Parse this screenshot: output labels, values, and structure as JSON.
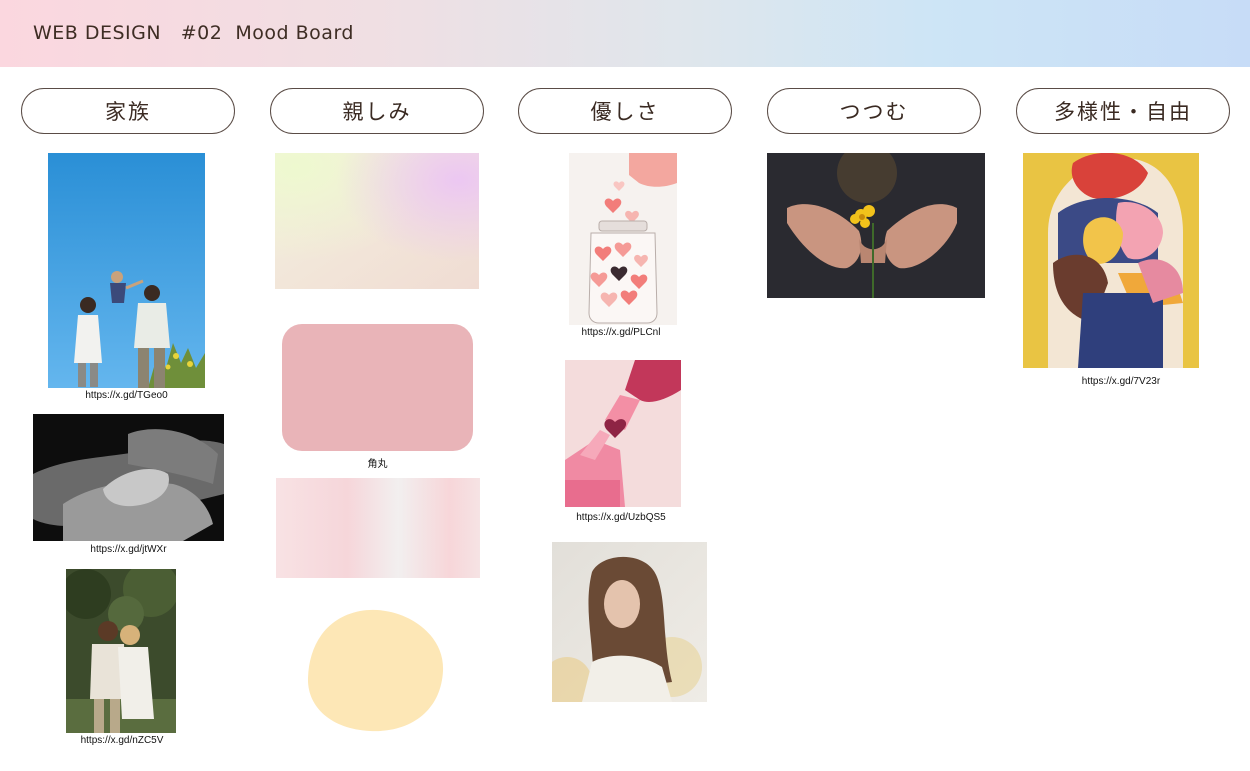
{
  "header": {
    "title": "WEB DESIGN   #02  Mood Board"
  },
  "columns": [
    {
      "label": "家族"
    },
    {
      "label": "親しみ"
    },
    {
      "label": "優しさ"
    },
    {
      "label": "つつむ"
    },
    {
      "label": "多様性・自由"
    }
  ],
  "captions": {
    "family_1": "https://x.gd/TGeo0",
    "family_2": "https://x.gd/jtWXr",
    "family_3": "https://x.gd/nZC5V",
    "familiar_card": "角丸",
    "kind_1": "https://x.gd/PLCnl",
    "kind_2": "https://x.gd/UzbQS5",
    "diverse_1": "https://x.gd/7V23r"
  },
  "colors": {
    "header_start": "#fbd7df",
    "header_end": "#c7dcf7",
    "rounded_card": "#e9b4b8",
    "blob": "#fde7b6"
  }
}
